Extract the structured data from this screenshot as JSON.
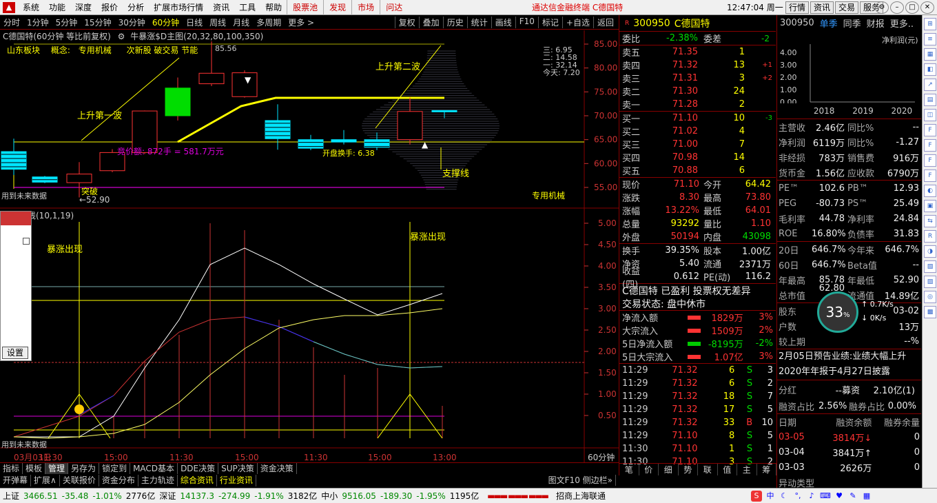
{
  "menu": {
    "items": [
      "系统",
      "功能",
      "深度",
      "报价",
      "分析",
      "扩展市场行情",
      "资讯",
      "工具",
      "帮助"
    ],
    "highlight": [
      "股票池",
      "发现",
      "市场",
      "问达"
    ],
    "center_title": "通达信金融终端  C德国特",
    "clock": "12:47:04 周一",
    "right_buttons": [
      "行情",
      "资讯",
      "交易",
      "服务"
    ]
  },
  "toolbar": {
    "periods": [
      "分时",
      "1分钟",
      "5分钟",
      "15分钟",
      "30分钟",
      "60分钟",
      "日线",
      "周线",
      "月线",
      "多周期",
      "更多 >"
    ],
    "active": "60分钟",
    "right": [
      "复权",
      "叠加",
      "历史",
      "统计",
      "画线",
      "F10",
      "标记",
      "+自选",
      "返回"
    ]
  },
  "chart": {
    "title": "C德国特(60分钟 等比前复权)",
    "indicator": "牛暴涨$D主图(20,32,80,100,350)",
    "info": [
      "山东板块",
      "概念:",
      "专用机械",
      "次新股 破交易 节能"
    ],
    "top_label": "85.56",
    "price_labels": [
      "三: 6.95",
      "二: 14.58",
      "一: 32.14",
      "今天: 7.20"
    ],
    "yaxis": [
      "85.00",
      "80.00",
      "75.00",
      "70.00",
      "65.00",
      "60.00",
      "55.00"
    ],
    "annotations": {
      "wave1": "上升第一波",
      "wave2": "上升第二波",
      "support": "支撑线",
      "auction": "竞价额: 872手 = 581.7万元",
      "breakout": "突破",
      "low": "←52.90",
      "turnover": "开盘换手: 6.38",
      "sector": "专用机械",
      "future1": "用到未来数据"
    },
    "lower_title": "线(10,1,19)",
    "lower_yaxis": [
      "5.00",
      "4.50",
      "4.00",
      "3.50",
      "3.00",
      "2.50",
      "2.00",
      "1.50",
      "1.00",
      "0.50"
    ],
    "surge1": "暴涨出现",
    "surge2": "暴涨出现",
    "future2": "用到未来数据",
    "xaxis": [
      "03月03日",
      "11:30",
      "15:00",
      "11:30",
      "15:00",
      "11:30",
      "15:00",
      "13:00"
    ],
    "period_label": "60分钟"
  },
  "popup": {
    "button": "设置"
  },
  "quote": {
    "code": "300950",
    "name": "C德国特",
    "ratio_label": "委比",
    "ratio": "-2.38%",
    "diff_label": "委差",
    "diff": "-2",
    "asks": [
      {
        "l": "卖五",
        "p": "71.35",
        "v": "1",
        "c": ""
      },
      {
        "l": "卖四",
        "p": "71.32",
        "v": "13",
        "c": "+1"
      },
      {
        "l": "卖三",
        "p": "71.31",
        "v": "3",
        "c": "+2"
      },
      {
        "l": "卖二",
        "p": "71.30",
        "v": "24",
        "c": ""
      },
      {
        "l": "卖一",
        "p": "71.28",
        "v": "2",
        "c": ""
      }
    ],
    "bids": [
      {
        "l": "买一",
        "p": "71.10",
        "v": "10",
        "c": "-3"
      },
      {
        "l": "买二",
        "p": "71.02",
        "v": "4",
        "c": ""
      },
      {
        "l": "买三",
        "p": "71.00",
        "v": "7",
        "c": ""
      },
      {
        "l": "买四",
        "p": "70.98",
        "v": "14",
        "c": ""
      },
      {
        "l": "买五",
        "p": "70.88",
        "v": "6",
        "c": ""
      }
    ],
    "stats": [
      [
        "现价",
        "71.10",
        "今开",
        "64.42"
      ],
      [
        "涨跌",
        "8.30",
        "最高",
        "73.80"
      ],
      [
        "涨幅",
        "13.22%",
        "最低",
        "64.01"
      ],
      [
        "总量",
        "93292",
        "量比",
        "1.10"
      ],
      [
        "外盘",
        "50194",
        "内盘",
        "43098"
      ]
    ],
    "stats2": [
      [
        "换手",
        "39.35%",
        "股本",
        "1.00亿"
      ],
      [
        "净资",
        "5.40",
        "流通",
        "2371万"
      ],
      [
        "收益(四)",
        "0.612",
        "PE(动)",
        "116.2"
      ]
    ],
    "status1": "C德国特 已盈利 投票权无差异",
    "status2": "交易状态: 盘中休市",
    "flows": [
      [
        "净流入额",
        "1829万",
        "3%"
      ],
      [
        "大宗流入",
        "1509万",
        "2%"
      ],
      [
        "5日净流入额",
        "-8195万",
        "-2%"
      ],
      [
        "5日大宗流入",
        "1.07亿",
        "3%"
      ]
    ],
    "ticks": [
      [
        "11:29",
        "71.32",
        "6",
        "S",
        "3"
      ],
      [
        "11:29",
        "71.32",
        "6",
        "S",
        "2"
      ],
      [
        "11:29",
        "71.32",
        "18",
        "S",
        "7"
      ],
      [
        "11:29",
        "71.32",
        "17",
        "S",
        "5"
      ],
      [
        "11:29",
        "71.32",
        "33",
        "B",
        "10"
      ],
      [
        "11:29",
        "71.10",
        "8",
        "S",
        "5"
      ],
      [
        "11:30",
        "71.10",
        "1",
        "S",
        "1"
      ],
      [
        "11:30",
        "71.10",
        "3",
        "S",
        "2"
      ]
    ],
    "tabs": [
      "笔",
      "价",
      "细",
      "势",
      "联",
      "值",
      "主",
      "筹"
    ]
  },
  "fund": {
    "code": "300950",
    "tabs": [
      "单季",
      "同季",
      "财报",
      "更多.."
    ],
    "chart_label": "净利润(元)",
    "yticks": [
      "4.00",
      "3.00",
      "2.00",
      "1.00",
      "0.00"
    ],
    "years": [
      "2018",
      "2019",
      "2020"
    ],
    "rows1": [
      [
        "主营收",
        "2.46亿",
        "同比%",
        "--"
      ],
      [
        "净利润",
        "6119万",
        "同比%",
        "-1.27"
      ],
      [
        "非经损",
        "783万",
        "销售费",
        "916万"
      ],
      [
        "货币金",
        "1.56亿",
        "应收款",
        "6790万"
      ]
    ],
    "rows2": [
      [
        "PE™",
        "102.6",
        "PB™",
        "12.93"
      ],
      [
        "PEG",
        "-80.73",
        "PS™",
        "25.49"
      ],
      [
        "毛利率",
        "44.78",
        "净利率",
        "24.84"
      ],
      [
        "ROE",
        "16.80%",
        "负债率",
        "31.83"
      ]
    ],
    "rows3": [
      [
        "20日",
        "646.7%",
        "今年来",
        "646.7%"
      ],
      [
        "60日",
        "646.7%",
        "Beta值",
        "--"
      ],
      [
        "年最高",
        "85.78",
        "年最低",
        "52.90"
      ],
      [
        "总市值",
        "62.80亿",
        "流通值",
        "14.89亿"
      ]
    ],
    "rows4": [
      [
        "股东",
        "",
        "",
        "03-02"
      ],
      [
        "户数",
        "",
        "",
        "13万"
      ],
      [
        "较上期",
        "",
        "",
        "--%"
      ]
    ],
    "gauge": "33",
    "speed_up": "0.7K/s",
    "speed_down": "0K/s",
    "news": [
      "2月05日预告业绩:业绩大幅上升",
      "2020年年报于4月27日披露"
    ],
    "dividend": [
      "分红",
      "--募资",
      "2.10亿(1)"
    ],
    "margin": [
      "融资占比",
      "2.56%",
      "融券占比",
      "0.00%"
    ],
    "margin_hdr": [
      "日期",
      "融资余额",
      "融券余量"
    ],
    "margin_rows": [
      [
        "03-05",
        "3814万↓",
        "0"
      ],
      [
        "03-04",
        "3841万↑",
        "0"
      ],
      [
        "03-03",
        "2626万",
        "0"
      ]
    ],
    "more": "异动类型"
  },
  "tabs1": [
    "指标",
    "模板",
    "管理",
    "另存为",
    "锁定到",
    "MACD基本",
    "DDE决策",
    "SUP决策",
    "资金决策"
  ],
  "tabs2": [
    "开弹幕",
    "扩展∧",
    "关联报价",
    "资金分布",
    "主力轨迹",
    "综合资讯",
    "行业资讯"
  ],
  "tabs2_right": "图文F10 侧边栏»",
  "status": {
    "sh_label": "上证",
    "sh": "3466.51",
    "sh_chg": "-35.48",
    "sh_pct": "-1.01%",
    "sh_amt": "2776亿",
    "sz_label": "深证",
    "sz": "14137.3",
    "sz_chg": "-274.99",
    "sz_pct": "-1.91%",
    "sz_amt": "3182亿",
    "zx_label": "中小",
    "zx": "9516.05",
    "zx_chg": "-189.30",
    "zx_pct": "-1.95%",
    "zx_amt": "1195亿",
    "broker": "招商上海联通"
  },
  "chart_data": {
    "type": "candlestick",
    "candles": [
      {
        "o": 62.5,
        "c": 58.8,
        "h": 65.2,
        "l": 57.6
      },
      {
        "o": 57.2,
        "c": 56.1,
        "h": 57.4,
        "l": 55.9
      },
      {
        "o": 56.0,
        "c": 57.8,
        "h": 60.3,
        "l": 52.9
      },
      {
        "o": 58.5,
        "c": 62.3,
        "h": 63.0,
        "l": 58.2
      },
      {
        "o": 62.3,
        "c": 71.0,
        "h": 71.1,
        "l": 62.0
      },
      {
        "o": 70.0,
        "c": 75.8,
        "h": 78.0,
        "l": 69.0
      },
      {
        "o": 76.7,
        "c": 78.9,
        "h": 85.56,
        "l": 76.2
      },
      {
        "o": 74.0,
        "c": 79.0,
        "h": 79.5,
        "l": 73.8
      },
      {
        "o": 69.0,
        "c": 65.2,
        "h": 72.4,
        "l": 62.9
      },
      {
        "o": 65.0,
        "c": 63.2,
        "h": 66.0,
        "l": 62.8
      },
      {
        "o": 65.0,
        "c": 64.5,
        "h": 67.0,
        "l": 64.0
      },
      {
        "o": 65.0,
        "c": 63.4,
        "h": 66.5,
        "l": 62.8
      },
      {
        "o": 65.0,
        "c": 70.9,
        "h": 73.8,
        "l": 64.0
      },
      {
        "o": 71.1,
        "c": 71.0,
        "h": 71.1,
        "l": 69.5
      }
    ],
    "ylim": [
      52,
      87
    ]
  }
}
